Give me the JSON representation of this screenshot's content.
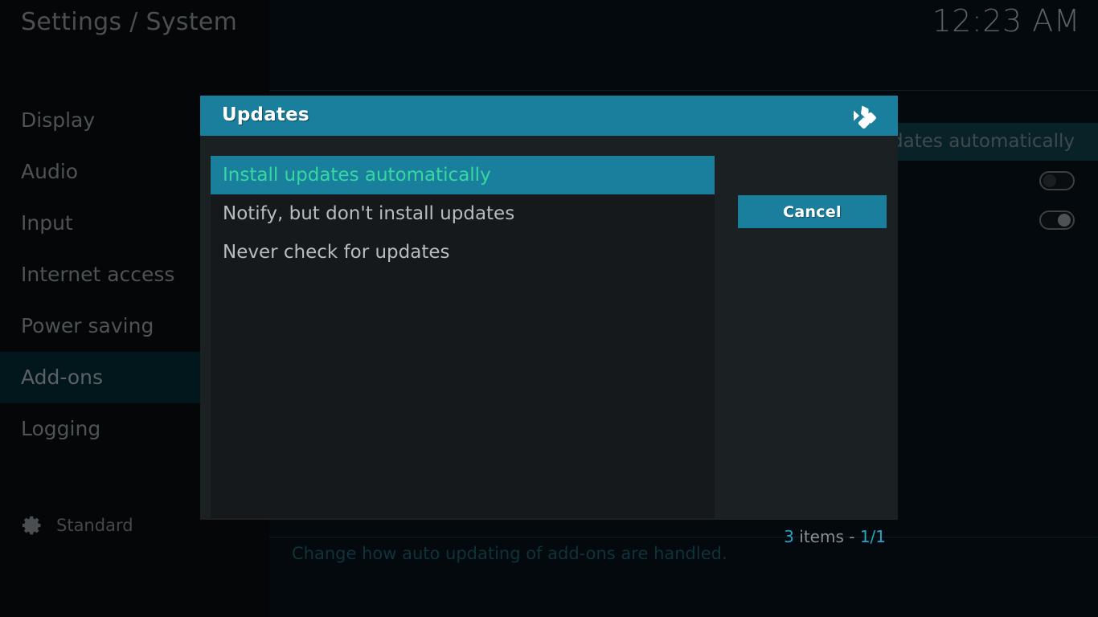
{
  "header": {
    "title": "Settings / System",
    "clock": "12:23 AM"
  },
  "sidebar": {
    "items": [
      {
        "label": "Display",
        "selected": false
      },
      {
        "label": "Audio",
        "selected": false
      },
      {
        "label": "Input",
        "selected": false
      },
      {
        "label": "Internet access",
        "selected": false
      },
      {
        "label": "Power saving",
        "selected": false
      },
      {
        "label": "Add-ons",
        "selected": true
      },
      {
        "label": "Logging",
        "selected": false
      }
    ],
    "profile": {
      "icon": "gear-icon",
      "label": "Standard"
    }
  },
  "main": {
    "highlighted_setting_label": "updates automatically",
    "toggles": [
      {
        "name": "setting-toggle-1",
        "state": "off"
      },
      {
        "name": "setting-toggle-2",
        "state": "on"
      }
    ],
    "help_text": "Change how auto updating of add-ons are handled."
  },
  "dialog": {
    "title": "Updates",
    "logo": "kodi-logo",
    "options": [
      {
        "label": "Install updates automatically",
        "selected": true
      },
      {
        "label": "Notify, but don't install updates",
        "selected": false
      },
      {
        "label": "Never check for updates",
        "selected": false
      }
    ],
    "cancel_label": "Cancel",
    "count": {
      "items_number": "3",
      "items_word": "items",
      "separator": "-",
      "page": "1/1",
      "full": "3 items - 1/1"
    }
  },
  "colors": {
    "accent_teal": "#1a7f9c",
    "selected_text_green": "#36d8a0",
    "count_accent": "#2aa3c4",
    "sidebar_selected_bg": "#02171c",
    "dialog_body_bg": "#1b2023",
    "list_panel_bg": "#16191b",
    "help_text": "#10333b"
  }
}
